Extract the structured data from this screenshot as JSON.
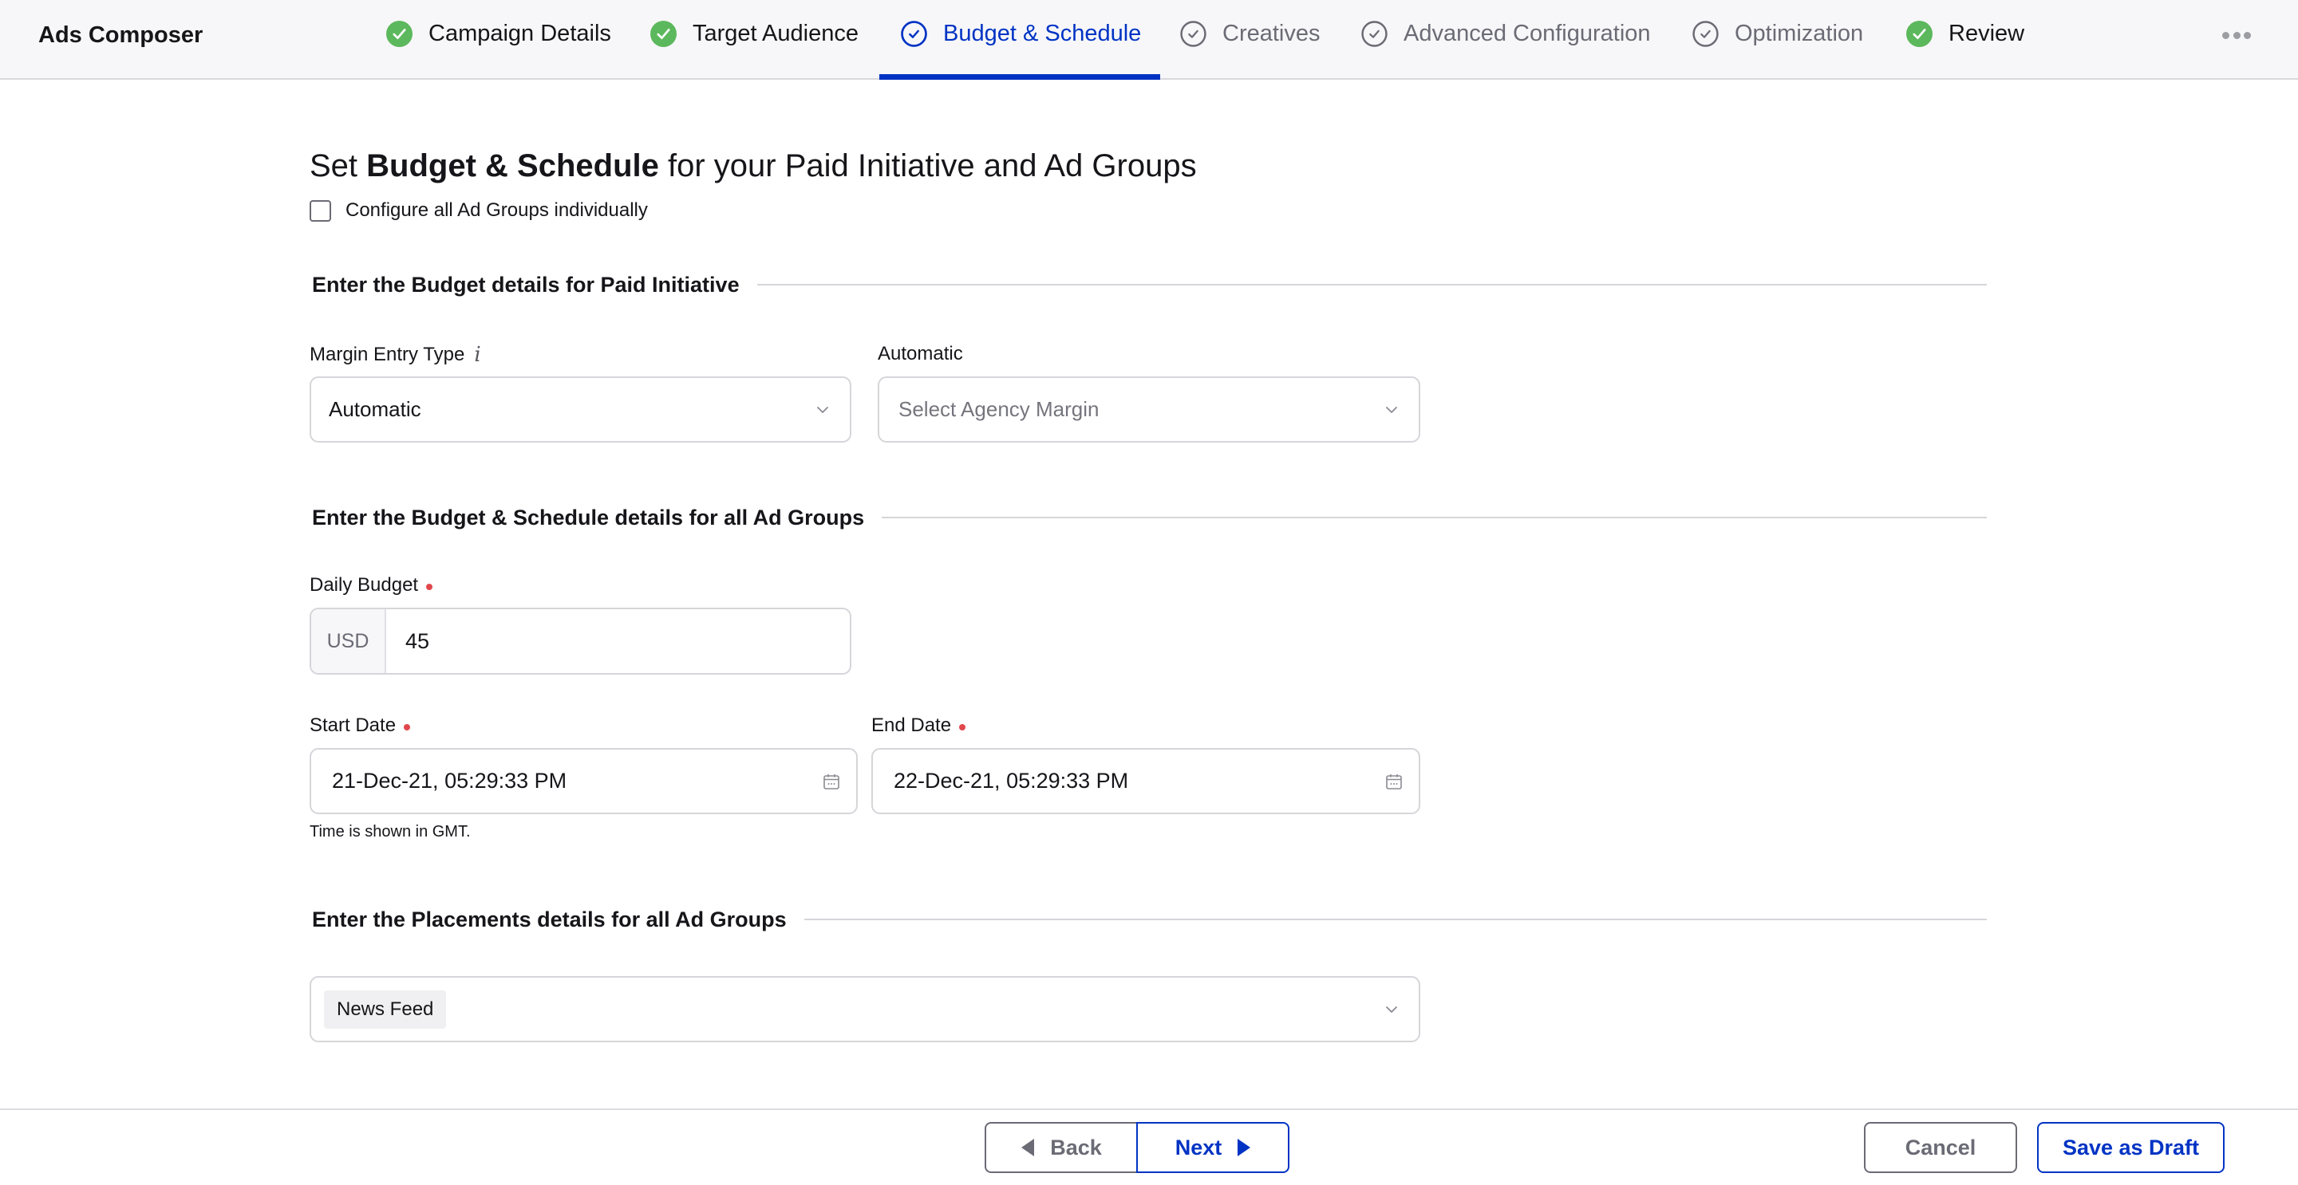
{
  "app": {
    "title": "Ads Composer"
  },
  "steps": [
    {
      "label": "Campaign Details",
      "status": "done",
      "icon": "check-circle-filled-icon"
    },
    {
      "label": "Target Audience",
      "status": "done",
      "icon": "check-circle-filled-icon"
    },
    {
      "label": "Budget & Schedule",
      "status": "active",
      "icon": "check-circle-outline-icon"
    },
    {
      "label": "Creatives",
      "status": "pending",
      "icon": "check-circle-outline-icon"
    },
    {
      "label": "Advanced Configuration",
      "status": "pending",
      "icon": "check-circle-outline-icon"
    },
    {
      "label": "Optimization",
      "status": "pending",
      "icon": "check-circle-outline-icon"
    },
    {
      "label": "Review",
      "status": "done",
      "icon": "check-circle-filled-icon"
    }
  ],
  "header": {
    "more_icon": "more-horizontal-icon"
  },
  "colors": {
    "accent": "#0033c4",
    "success": "#5cb85c",
    "muted": "#6b6b75",
    "required": "#e0474c",
    "border": "#d6d6da"
  },
  "page": {
    "title_prefix": "Set ",
    "title_bold": "Budget & Schedule",
    "title_suffix": " for your Paid Initiative and Ad Groups",
    "configure_individually": {
      "label": "Configure all Ad Groups individually",
      "checked": false
    }
  },
  "budget_section": {
    "title": "Enter the Budget details for Paid Initiative",
    "margin_entry_type": {
      "label": "Margin Entry Type",
      "info_icon": "i",
      "value": "Automatic"
    },
    "agency_margin": {
      "label": "Automatic",
      "placeholder": "Select Agency Margin",
      "value": ""
    }
  },
  "schedule_section": {
    "title": "Enter the Budget & Schedule details for all Ad Groups",
    "daily_budget": {
      "label": "Daily Budget",
      "required": true,
      "currency": "USD",
      "value": "45"
    },
    "start_date": {
      "label": "Start Date",
      "required": true,
      "value": "21-Dec-21, 05:29:33 PM"
    },
    "end_date": {
      "label": "End Date",
      "required": true,
      "value": "22-Dec-21, 05:29:33 PM"
    },
    "timezone_note": "Time is shown in GMT."
  },
  "placements_section": {
    "title": "Enter the Placements details for all Ad Groups",
    "selected": [
      "News Feed"
    ]
  },
  "footer": {
    "back_label": "Back",
    "next_label": "Next",
    "cancel_label": "Cancel",
    "save_draft_label": "Save as Draft"
  }
}
